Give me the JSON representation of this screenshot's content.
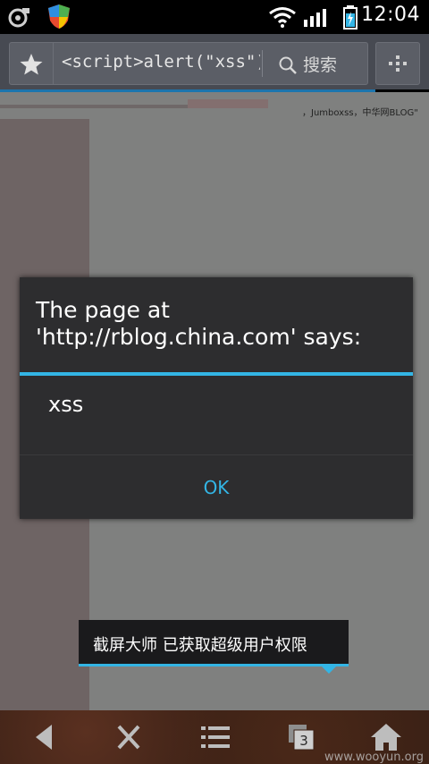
{
  "status_bar": {
    "time": "12:04"
  },
  "browser": {
    "url_text": "<script>alert(\"xss\")",
    "search_label": "搜索"
  },
  "page": {
    "credit_text": "，Jumboxss，中华网BLOG\""
  },
  "dialog": {
    "title": "The page at 'http://rblog.china.com' says:",
    "message": "xss",
    "ok_label": "OK"
  },
  "toast": {
    "text": "截屏大师 已获取超级用户权限"
  },
  "watermark": {
    "text": "www.wooyun.org"
  },
  "colors": {
    "accent": "#33b5e5",
    "dialog_bg": "#2d2d2f"
  }
}
